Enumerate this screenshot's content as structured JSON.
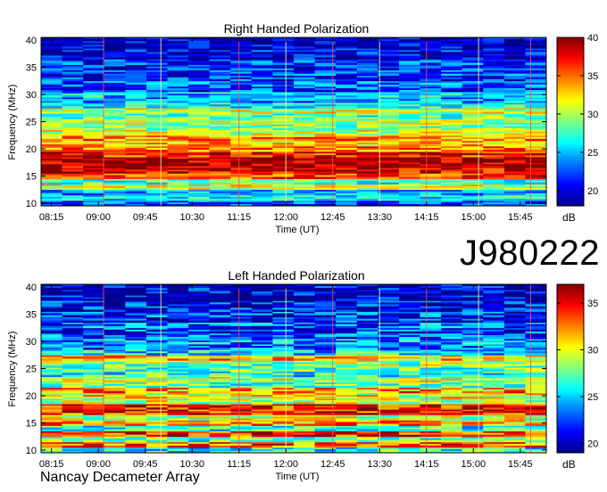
{
  "observation_id": "J980222",
  "footer_label": "Nancay Decameter Array",
  "chart_data": [
    {
      "type": "heatmap",
      "title": "Right Handed Polarization",
      "xlabel": "Time (UT)",
      "ylabel": "Frequency (MHz)",
      "x_ticks": [
        "08:15",
        "09:00",
        "09:45",
        "10:30",
        "11:15",
        "12:00",
        "12:45",
        "13:30",
        "14:15",
        "15:00",
        "15:45"
      ],
      "xlim": [
        "08:05",
        "16:10"
      ],
      "y_ticks": [
        10,
        15,
        20,
        25,
        30,
        35,
        40
      ],
      "ylim": [
        9.5,
        40.5
      ],
      "colorbar": {
        "label": "dB",
        "ticks": [
          20,
          25,
          30,
          35,
          40
        ],
        "range": [
          18,
          40
        ]
      },
      "colormap": [
        "#00008f",
        "#0000ff",
        "#00a0ff",
        "#00ffff",
        "#80ff80",
        "#ffff00",
        "#ff8000",
        "#ff0000",
        "#800000"
      ],
      "frequency_profile_db": [
        {
          "mhz": 10,
          "db": 22
        },
        {
          "mhz": 11,
          "db": 26
        },
        {
          "mhz": 12,
          "db": 24
        },
        {
          "mhz": 13,
          "db": 31
        },
        {
          "mhz": 14,
          "db": 27
        },
        {
          "mhz": 15,
          "db": 36
        },
        {
          "mhz": 16,
          "db": 38
        },
        {
          "mhz": 17,
          "db": 39
        },
        {
          "mhz": 18,
          "db": 39
        },
        {
          "mhz": 19,
          "db": 37
        },
        {
          "mhz": 20,
          "db": 35
        },
        {
          "mhz": 21,
          "db": 33
        },
        {
          "mhz": 22,
          "db": 34
        },
        {
          "mhz": 23,
          "db": 31
        },
        {
          "mhz": 24,
          "db": 29
        },
        {
          "mhz": 25,
          "db": 30
        },
        {
          "mhz": 26,
          "db": 28
        },
        {
          "mhz": 27,
          "db": 31
        },
        {
          "mhz": 28,
          "db": 26
        },
        {
          "mhz": 29,
          "db": 24
        },
        {
          "mhz": 30,
          "db": 25
        },
        {
          "mhz": 31,
          "db": 22
        },
        {
          "mhz": 32,
          "db": 23
        },
        {
          "mhz": 33,
          "db": 21
        },
        {
          "mhz": 34,
          "db": 22
        },
        {
          "mhz": 35,
          "db": 21
        },
        {
          "mhz": 36,
          "db": 22
        },
        {
          "mhz": 37,
          "db": 20
        },
        {
          "mhz": 38,
          "db": 20
        },
        {
          "mhz": 39,
          "db": 19
        },
        {
          "mhz": 40,
          "db": 19
        }
      ],
      "marker_times": [
        "09:05",
        "10:00",
        "11:15",
        "12:00",
        "12:45",
        "13:30",
        "14:15",
        "15:05",
        "15:55"
      ]
    },
    {
      "type": "heatmap",
      "title": "Left Handed Polarization",
      "xlabel": "Time (UT)",
      "ylabel": "Frequency (MHz)",
      "x_ticks": [
        "08:15",
        "09:00",
        "09:45",
        "10:30",
        "11:15",
        "12:00",
        "12:45",
        "13:30",
        "14:15",
        "15:00",
        "15:45"
      ],
      "xlim": [
        "08:05",
        "16:10"
      ],
      "y_ticks": [
        10,
        15,
        20,
        25,
        30,
        35,
        40
      ],
      "ylim": [
        9.5,
        40.5
      ],
      "colorbar": {
        "label": "dB",
        "ticks": [
          20,
          25,
          30,
          35
        ],
        "range": [
          19,
          37
        ]
      },
      "colormap": [
        "#00008f",
        "#0000ff",
        "#00a0ff",
        "#00ffff",
        "#80ff80",
        "#ffff00",
        "#ff8000",
        "#ff0000",
        "#800000"
      ],
      "frequency_profile_db": [
        {
          "mhz": 10,
          "db": 26
        },
        {
          "mhz": 11,
          "db": 33
        },
        {
          "mhz": 12,
          "db": 27
        },
        {
          "mhz": 13,
          "db": 34
        },
        {
          "mhz": 14,
          "db": 26
        },
        {
          "mhz": 15,
          "db": 32
        },
        {
          "mhz": 16,
          "db": 29
        },
        {
          "mhz": 17,
          "db": 34
        },
        {
          "mhz": 18,
          "db": 35
        },
        {
          "mhz": 19,
          "db": 29
        },
        {
          "mhz": 20,
          "db": 30
        },
        {
          "mhz": 21,
          "db": 32
        },
        {
          "mhz": 22,
          "db": 27
        },
        {
          "mhz": 23,
          "db": 29
        },
        {
          "mhz": 24,
          "db": 26
        },
        {
          "mhz": 25,
          "db": 27
        },
        {
          "mhz": 26,
          "db": 28
        },
        {
          "mhz": 27,
          "db": 31
        },
        {
          "mhz": 28,
          "db": 25
        },
        {
          "mhz": 29,
          "db": 23
        },
        {
          "mhz": 30,
          "db": 24
        },
        {
          "mhz": 31,
          "db": 23
        },
        {
          "mhz": 32,
          "db": 22
        },
        {
          "mhz": 33,
          "db": 23
        },
        {
          "mhz": 34,
          "db": 21
        },
        {
          "mhz": 35,
          "db": 22
        },
        {
          "mhz": 36,
          "db": 21
        },
        {
          "mhz": 37,
          "db": 21
        },
        {
          "mhz": 38,
          "db": 20
        },
        {
          "mhz": 39,
          "db": 20
        },
        {
          "mhz": 40,
          "db": 20
        }
      ],
      "marker_times": [
        "09:05",
        "10:00",
        "11:15",
        "12:00",
        "12:45",
        "13:30",
        "14:15",
        "15:05",
        "15:55"
      ]
    }
  ]
}
